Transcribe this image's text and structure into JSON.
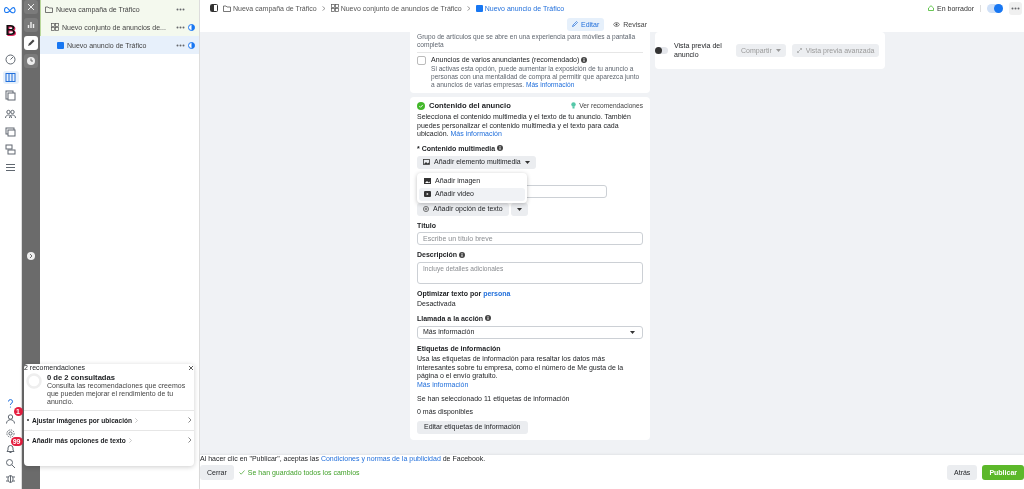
{
  "app_rail": {
    "account_initial": "B",
    "nav": [
      {
        "kind": "gauge",
        "selected": false
      },
      {
        "kind": "columns",
        "selected": true
      },
      {
        "kind": "pages",
        "selected": false
      },
      {
        "kind": "people",
        "selected": false
      },
      {
        "kind": "gallery",
        "selected": false
      },
      {
        "kind": "stack",
        "selected": false
      },
      {
        "kind": "menu",
        "selected": false
      }
    ],
    "bottom": [
      {
        "kind": "help"
      },
      {
        "kind": "person",
        "badge": "1"
      },
      {
        "kind": "gear"
      },
      {
        "kind": "bell",
        "badge": "99"
      },
      {
        "kind": "search"
      },
      {
        "kind": "bug"
      }
    ]
  },
  "tool_strip": {
    "tools": [
      {
        "kind": "close",
        "selected": false
      },
      {
        "kind": "chart",
        "selected": false
      },
      {
        "kind": "pencil",
        "selected": true
      },
      {
        "kind": "clock",
        "selected": false
      }
    ]
  },
  "tree": [
    {
      "kind": "campaign",
      "label": "Nueva campaña de Tráfico",
      "selected": false,
      "children": [
        {
          "kind": "ad_set",
          "label": "Nuevo conjunto de anuncios de...",
          "selected": false,
          "children": [
            {
              "kind": "ad",
              "label": "Nuevo anuncio de Tráfico",
              "selected": true
            }
          ]
        }
      ]
    }
  ],
  "breadcrumb": [
    {
      "kind": "campaign",
      "label": "Nueva campaña de Tráfico",
      "selected": false
    },
    {
      "kind": "ad_set",
      "label": "Nuevo conjunto de anuncios de Tráfico",
      "selected": false
    },
    {
      "kind": "ad",
      "label": "Nuevo anuncio de Tráfico",
      "selected": true
    }
  ],
  "status": {
    "label": "En borrador",
    "toggle_on": true
  },
  "mode_tabs": [
    {
      "kind": "edit",
      "label": "Editar",
      "selected": true
    },
    {
      "kind": "review",
      "label": "Revisar",
      "selected": false
    }
  ],
  "form": {
    "format_option_tail": "Grupo de artículos que se abre en una experiencia para móviles a pantalla completa",
    "multi_advertiser": {
      "label": "Anuncios de varios anunciantes (recomendado)",
      "checked": false,
      "description": "Si activas esta opción, puede aumentar la exposición de tu anuncio a personas con una mentalidad de compra al permitir que aparezca junto a anuncios de varias empresas.",
      "link": "Más información"
    },
    "ad_content": {
      "title": "Contenido del anuncio",
      "complete": true,
      "recommendations_link": "Ver recomendaciones",
      "description": "Selecciona el contenido multimedia y el texto de tu anuncio. También puedes personalizar el contenido multimedia y el texto para cada ubicación.",
      "link": "Más información",
      "media_label": "* Contenido multimedia",
      "media_button": "Añadir elemento multimedia",
      "media_menu": [
        {
          "kind": "image",
          "label": "Añadir imagen",
          "selected": false
        },
        {
          "kind": "video",
          "label": "Añadir video",
          "selected": true
        }
      ],
      "text_option_button": "Añadir opción de texto",
      "headline": {
        "label": "Título",
        "placeholder": "Escribe un título breve"
      },
      "description_field": {
        "label": "Descripción",
        "placeholder": "Incluye detalles adicionales"
      },
      "optimize": {
        "label": "Optimizar texto por",
        "link": "persona",
        "value": "Desactivada"
      },
      "cta": {
        "label": "Llamada a la acción",
        "value": "Más información"
      },
      "info_labels": {
        "title": "Etiquetas de información",
        "description": "Usa las etiquetas de información para resaltar los datos más interesantes sobre tu empresa, como el número de Me gusta de la página o el envío gratuito.",
        "link": "Más información",
        "selected_count": "Se han seleccionado 11 etiquetas de información",
        "available": "0 más disponibles",
        "edit_button": "Editar etiquetas de información"
      }
    }
  },
  "preview": {
    "label": "Vista previa del anuncio",
    "toggle_on": false,
    "share_button": {
      "label": "Compartir",
      "disabled": true
    },
    "advanced_button": {
      "label": "Vista previa avanzada",
      "disabled": true
    }
  },
  "recommendations": {
    "title": "2 recomendaciones",
    "progress": "0 de 2 consultadas",
    "level": 0,
    "description": "Consulta las recomendaciones que creemos que pueden mejorar el rendimiento de tu anuncio.",
    "items": [
      {
        "label": "Ajustar imágenes por ubicación"
      },
      {
        "label": "Añadir más opciones de texto"
      }
    ]
  },
  "footer": {
    "terms_before": "Al hacer clic en \"Publicar\", aceptas las ",
    "terms_link": "Condiciones y normas de la publicidad",
    "terms_after": " de Facebook.",
    "close_button": "Cerrar",
    "saved": "Se han guardado todos los cambios",
    "back_button": "Atrás",
    "publish_button": "Publicar"
  }
}
